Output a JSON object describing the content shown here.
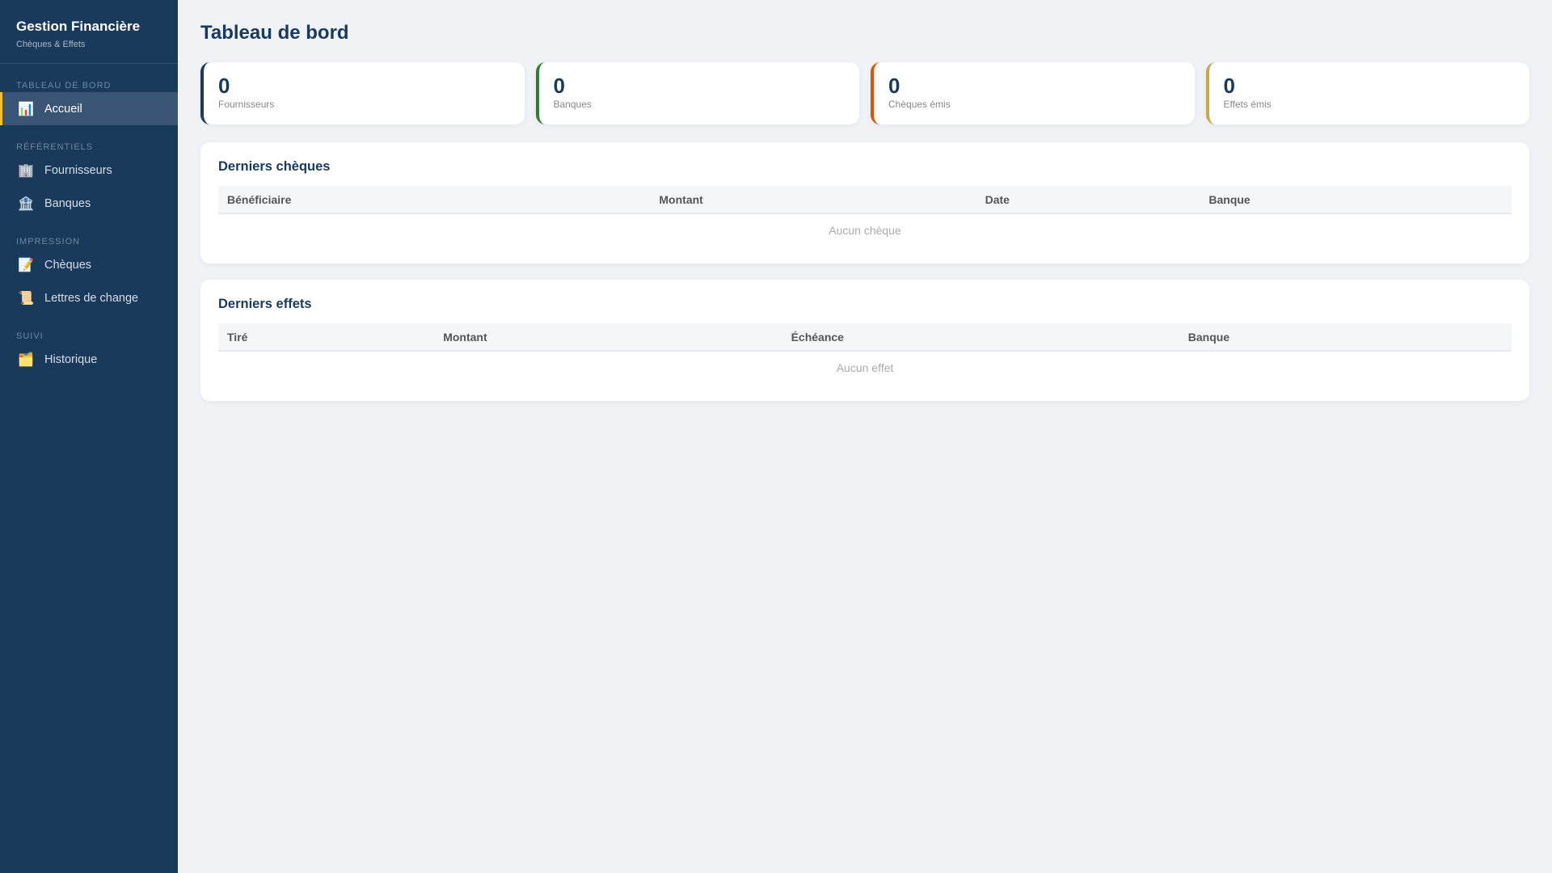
{
  "sidebar": {
    "title": "Gestion Financière",
    "subtitle": "Chèques & Effets",
    "sections": [
      {
        "label": "TABLEAU DE BORD",
        "items": [
          {
            "label": "Accueil",
            "icon": "📊"
          }
        ]
      },
      {
        "label": "RÉFÉRENTIELS",
        "items": [
          {
            "label": "Fournisseurs",
            "icon": "🏢"
          },
          {
            "label": "Banques",
            "icon": "🏦"
          }
        ]
      },
      {
        "label": "IMPRESSION",
        "items": [
          {
            "label": "Chèques",
            "icon": "📝"
          },
          {
            "label": "Lettres de change",
            "icon": "📜"
          }
        ]
      },
      {
        "label": "SUIVI",
        "items": [
          {
            "label": "Historique",
            "icon": "🗂️"
          }
        ]
      }
    ]
  },
  "page": {
    "title": "Tableau de bord"
  },
  "stats": [
    {
      "value": "0",
      "label": "Fournisseurs",
      "color": "#1a3a5c"
    },
    {
      "value": "0",
      "label": "Banques",
      "color": "#2e7d32"
    },
    {
      "value": "0",
      "label": "Chèques émis",
      "color": "#e65100"
    },
    {
      "value": "0",
      "label": "Effets émis",
      "color": "#c9a84c"
    }
  ],
  "cheques": {
    "title": "Derniers chèques",
    "columns": [
      "Bénéficiaire",
      "Montant",
      "Date",
      "Banque"
    ],
    "empty": "Aucun chèque"
  },
  "effets": {
    "title": "Derniers effets",
    "columns": [
      "Tiré",
      "Montant",
      "Échéance",
      "Banque"
    ],
    "empty": "Aucun effet"
  }
}
